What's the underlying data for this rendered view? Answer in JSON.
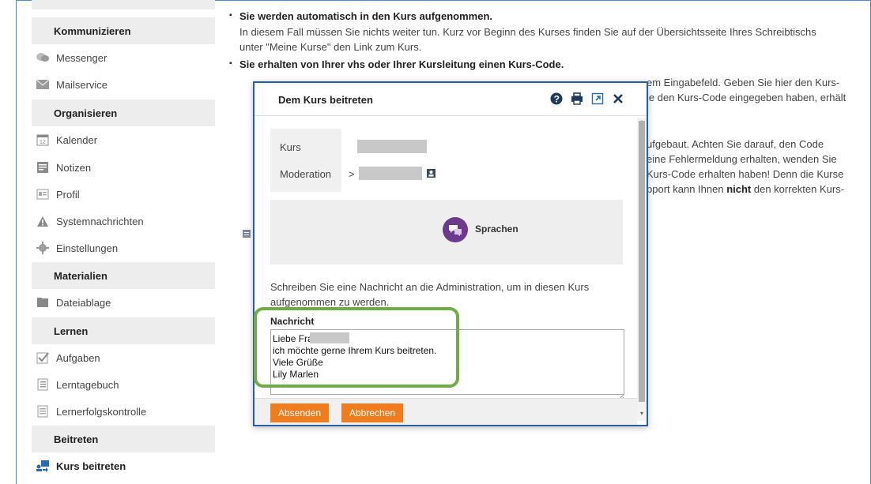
{
  "sidebar": {
    "sections": [
      {
        "heading": "Kommunizieren",
        "items": [
          {
            "label": "Messenger",
            "icon": "messenger-icon"
          },
          {
            "label": "Mailservice",
            "icon": "mail-icon"
          }
        ]
      },
      {
        "heading": "Organisieren",
        "items": [
          {
            "label": "Kalender",
            "icon": "calendar-icon"
          },
          {
            "label": "Notizen",
            "icon": "notes-icon"
          },
          {
            "label": "Profil",
            "icon": "profile-icon"
          },
          {
            "label": "Systemnachrichten",
            "icon": "warning-icon"
          },
          {
            "label": "Einstellungen",
            "icon": "gear-icon"
          }
        ]
      },
      {
        "heading": "Materialien",
        "items": [
          {
            "label": "Dateiablage",
            "icon": "folder-icon"
          }
        ]
      },
      {
        "heading": "Lernen",
        "items": [
          {
            "label": "Aufgaben",
            "icon": "task-icon"
          },
          {
            "label": "Lerntagebuch",
            "icon": "diary-icon"
          },
          {
            "label": "Lernerfolgskontrolle",
            "icon": "checklist-icon"
          }
        ]
      },
      {
        "heading": "Beitreten",
        "items": [
          {
            "label": "Kurs beitreten",
            "icon": "join-course-icon"
          }
        ]
      }
    ]
  },
  "main": {
    "bullet1_title": "Sie werden automatisch in den Kurs aufgenommen.",
    "bullet1_text_1": "In diesem Fall müssen Sie nichts weiter tun. Kurz vor Beginn des Kurses finden Sie auf der Übersichtsseite Ihres Schreibtischs",
    "bullet1_text_2": "unter \"Meine Kurse\" den Link zum Kurs.",
    "bullet2_title": "Sie erhalten von Ihrer vhs oder Ihrer Kursleitung einen Kurs-Code.",
    "right_line_1": "em Eingabefeld. Geben Sie hier den Kurs-",
    "right_line_2": "ie den Kurs-Code eingegeben haben, erhält",
    "right_line_3": "ufgebaut. Achten Sie darauf, den Code",
    "right_line_4": "eine Fehlermeldung erhalten, wenden Sie",
    "right_line_5": "Kurs-Code erhalten haben! Denn die Kurse",
    "right_line_6a": "pport kann Ihnen ",
    "right_line_6b": "nicht",
    "right_line_6c": " den korrekten Kurs-"
  },
  "modal": {
    "title": "Dem Kurs beitreten",
    "icons": [
      "help-icon",
      "print-icon",
      "external-link-icon",
      "close-icon"
    ],
    "kurs_label": "Kurs",
    "moderation_label": "Moderation",
    "moderation_arrow": ">",
    "language_label": "Sprachen",
    "instruction": "Schreiben Sie eine Nachricht an die Administration, um in diesen Kurs aufgenommen zu werden.",
    "message_label": "Nachricht",
    "message_value": "Liebe Frau \nich möchte gerne Ihrem Kurs beitreten.\nViele Grüße\nLily Marlen",
    "submit_label": "Absenden",
    "cancel_label": "Abbrechen"
  },
  "colors": {
    "accent_orange": "#f07c1e",
    "modal_border": "#2a5fa8",
    "highlight_green": "#6fac46",
    "language_purple": "#6b3a8c"
  }
}
